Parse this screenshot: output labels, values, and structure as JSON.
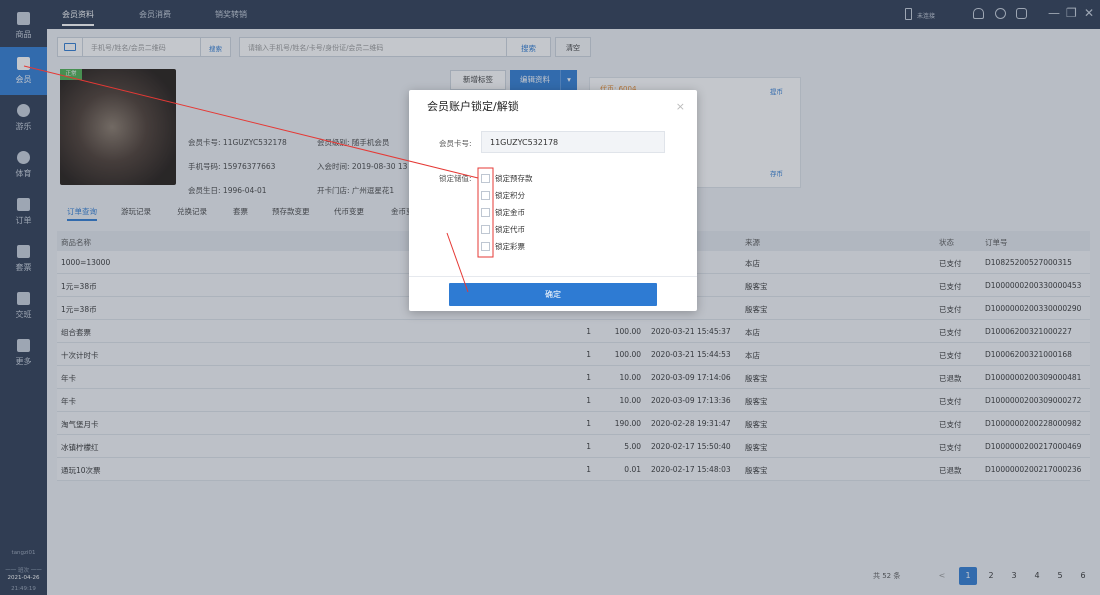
{
  "sidebar": {
    "items": [
      {
        "label": "商品",
        "active": false
      },
      {
        "label": "会员",
        "active": true
      },
      {
        "label": "游乐",
        "active": false
      },
      {
        "label": "体育",
        "active": false
      },
      {
        "label": "订单",
        "active": false
      },
      {
        "label": "套票",
        "active": false
      },
      {
        "label": "交班",
        "active": false
      },
      {
        "label": "更多",
        "active": false
      }
    ],
    "user": "tangzi01",
    "date": "2021-04-26",
    "time": "21:49:19",
    "divider": "一一 班次 一一"
  },
  "topbar": {
    "tabs": [
      {
        "label": "会员资料",
        "active": true
      },
      {
        "label": "会员消费",
        "active": false
      },
      {
        "label": "销奖转销",
        "active": false
      }
    ],
    "device_label": "未连接"
  },
  "search": {
    "input1_placeholder": "手机号/姓名/会员二维码",
    "input1_button": "搜索",
    "input2_placeholder": "请输入手机号/姓名/卡号/身份证/会员二维码",
    "search_button": "搜索",
    "clear_button": "清空"
  },
  "member": {
    "badge": "正常",
    "card_no_label": "会员卡号:",
    "card_no": "11GUZYC532178",
    "level_label": "会员级别:",
    "level": "随手机会员",
    "phone_label": "手机号码:",
    "phone": "15976377663",
    "join_label": "入会时间:",
    "join": "2019-08-30 13",
    "birthday_label": "会员生日:",
    "birthday": "1996-04-01",
    "store_label": "开卡门店:",
    "store": "广州逗星花1",
    "new_tag_button": "新增标签",
    "edit_button": "编辑资料",
    "card_orange": "代币: 6004",
    "card_link_top": "提币",
    "card_link_bottom": "存币"
  },
  "tabs": [
    "订单查询",
    "游玩记录",
    "兑换记录",
    "套票",
    "预存款变更",
    "代币变更",
    "金币变"
  ],
  "table": {
    "headers": [
      "商品名称",
      "来源",
      "状态",
      "订单号"
    ],
    "rows": [
      {
        "name": "1000=13000",
        "qty": "",
        "price": "",
        "time": "16:16:49",
        "source": "本店",
        "status": "已支付",
        "order": "D10825200527000315"
      },
      {
        "name": "1元=38币",
        "qty": "",
        "price": "",
        "time": "16:33:58",
        "source": "殷客宝",
        "status": "已支付",
        "order": "D1000000200330000453"
      },
      {
        "name": "1元=38币",
        "qty": "",
        "price": "",
        "time": "16:32:29",
        "source": "殷客宝",
        "status": "已支付",
        "order": "D1000000200330000290"
      },
      {
        "name": "组合套票",
        "qty": "1",
        "price": "100.00",
        "time": "2020-03-21 15:45:37",
        "source": "本店",
        "status": "已支付",
        "order": "D10006200321000227"
      },
      {
        "name": "十次计时卡",
        "qty": "1",
        "price": "100.00",
        "time": "2020-03-21 15:44:53",
        "source": "本店",
        "status": "已支付",
        "order": "D10006200321000168"
      },
      {
        "name": "年卡",
        "qty": "1",
        "price": "10.00",
        "time": "2020-03-09 17:14:06",
        "source": "殷客宝",
        "status": "已退款",
        "order": "D1000000200309000481"
      },
      {
        "name": "年卡",
        "qty": "1",
        "price": "10.00",
        "time": "2020-03-09 17:13:36",
        "source": "殷客宝",
        "status": "已支付",
        "order": "D1000000200309000272"
      },
      {
        "name": "淘气堡月卡",
        "qty": "1",
        "price": "190.00",
        "time": "2020-02-28 19:31:47",
        "source": "殷客宝",
        "status": "已支付",
        "order": "D1000000200228000982"
      },
      {
        "name": "冰镇柠檬红",
        "qty": "1",
        "price": "5.00",
        "time": "2020-02-17 15:50:40",
        "source": "殷客宝",
        "status": "已支付",
        "order": "D1000000200217000469"
      },
      {
        "name": "通玩10次票",
        "qty": "1",
        "price": "0.01",
        "time": "2020-02-17 15:48:03",
        "source": "殷客宝",
        "status": "已退款",
        "order": "D1000000200217000236"
      }
    ]
  },
  "pager": {
    "total": "共 52 条",
    "prev": "<",
    "pages": [
      "1",
      "2",
      "3",
      "4",
      "5",
      "6"
    ],
    "current": "1",
    "next": ">"
  },
  "modal": {
    "title": "会员账户锁定/解锁",
    "close": "×",
    "card_label": "会员卡号:",
    "card_value": "11GUZYC532178",
    "lock_label": "锁定储值:",
    "options": [
      "锁定预存款",
      "锁定积分",
      "锁定金币",
      "锁定代币",
      "锁定彩票"
    ],
    "ok_button": "确定"
  },
  "colors": {
    "accent": "#2e7bd3",
    "sidebar_bg": "#2c3a52",
    "annotation": "#e53935"
  }
}
